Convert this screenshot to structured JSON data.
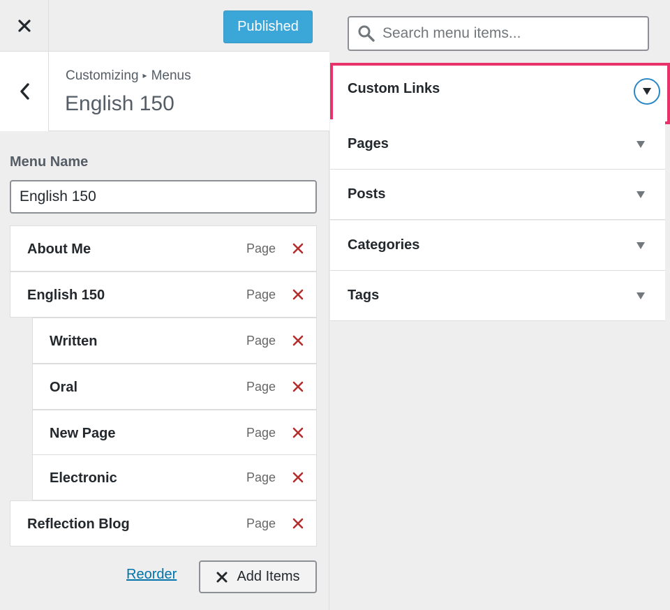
{
  "topbar": {
    "close_icon": "close-icon",
    "publish_label": "Published"
  },
  "header": {
    "breadcrumb_parent": "Customizing",
    "breadcrumb_sep": "▸",
    "breadcrumb_current": "Menus",
    "title": "English 150"
  },
  "menu": {
    "name_label": "Menu Name",
    "name_value": "English 150",
    "items": [
      {
        "title": "About Me",
        "type": "Page"
      },
      {
        "title": "English 150",
        "type": "Page"
      },
      {
        "title": "Written",
        "type": "Page"
      },
      {
        "title": "Oral",
        "type": "Page"
      },
      {
        "title": "New Page",
        "type": "Page"
      },
      {
        "title": "Electronic",
        "type": "Page"
      },
      {
        "title": "Reflection Blog",
        "type": "Page"
      }
    ],
    "reorder_label": "Reorder",
    "add_items_label": "Add Items"
  },
  "search": {
    "placeholder": "Search menu items..."
  },
  "sections": [
    {
      "title": "Custom Links"
    },
    {
      "title": "Pages"
    },
    {
      "title": "Posts"
    },
    {
      "title": "Categories"
    },
    {
      "title": "Tags"
    }
  ],
  "colors": {
    "publish_bg": "#1c9bd6",
    "delete_red": "#b32d2e",
    "highlight": "#e8336a",
    "link": "#0073aa"
  }
}
